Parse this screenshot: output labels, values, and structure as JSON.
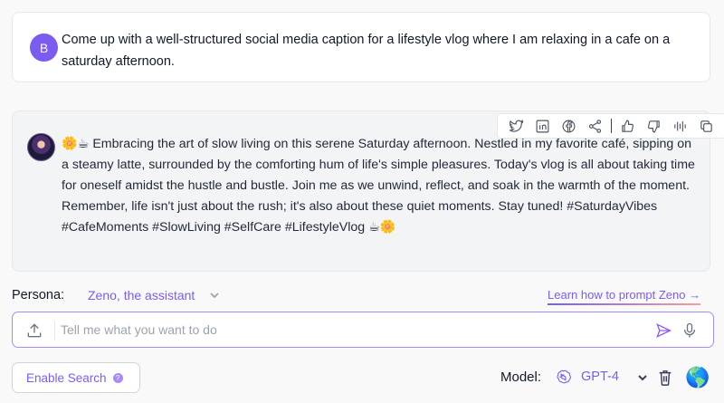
{
  "user_message": {
    "avatar_initial": "B",
    "text": "Come up with a well-structured social media caption for a lifestyle vlog where I am relaxing in a cafe on a saturday afternoon."
  },
  "ai_message": {
    "text": "🌼☕ Embracing the art of slow living on this serene Saturday afternoon. Nestled in my favorite café, sipping on a steamy latte, surrounded by the comforting hum of life's simple pleasures. Today's vlog is all about taking time for oneself amidst the hustle and bustle. Join me as we unwind, reflect, and soak in the warmth of the moment. Remember, life isn't just about the rush; it's also about these quiet moments. Stay tuned! #SaturdayVibes #CafeMoments #SlowLiving #SelfCare #LifestyleVlog ☕🌼",
    "actions": [
      "twitter-icon",
      "linkedin-icon",
      "facebook-icon",
      "share-icon",
      "thumbs-up-icon",
      "thumbs-down-icon",
      "audio-wave-icon",
      "copy-icon"
    ]
  },
  "persona": {
    "label": "Persona:",
    "value": "Zeno, the assistant"
  },
  "learn_link": "Learn how to prompt Zeno →",
  "input": {
    "placeholder": "Tell me what you want to do"
  },
  "search_button": {
    "label": "Enable Search",
    "help": "?"
  },
  "model": {
    "label": "Model:",
    "value": "GPT-4"
  },
  "colors": {
    "accent": "#7c5cf0",
    "avatar_bg": "#7c5cf0",
    "input_border": "#a78bfa"
  }
}
